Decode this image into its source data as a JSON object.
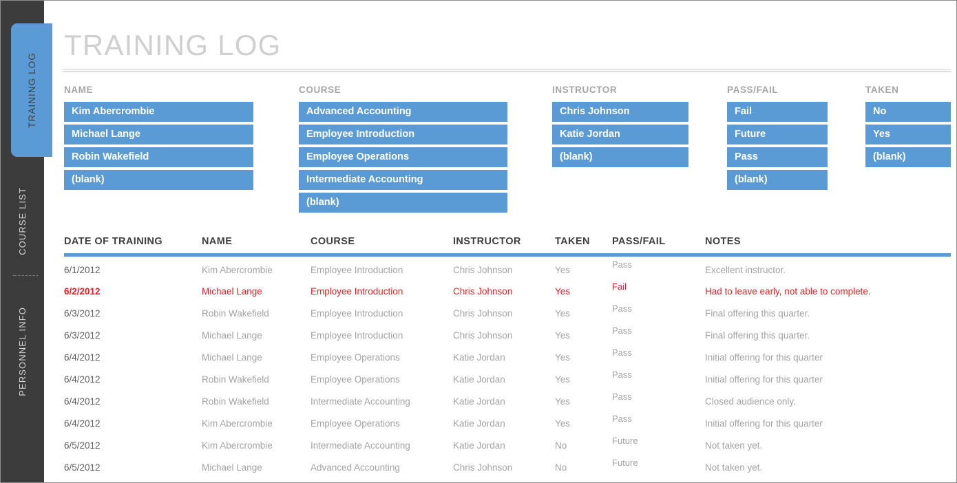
{
  "sidebar": {
    "tabs": [
      {
        "label": "TRAINING LOG",
        "active": true
      },
      {
        "label": "COURSE LIST",
        "active": false
      },
      {
        "label": "PERSONNEL INFO",
        "active": false
      }
    ]
  },
  "page": {
    "title": "TRAINING LOG",
    "accent_color": "#5B9BD5",
    "alert_color": "#EE1C25",
    "title_color": "#CFCFCF",
    "sidebar_color": "#3C3C3C"
  },
  "slicers": [
    {
      "title": "NAME",
      "items": [
        "Kim Abercrombie",
        "Michael Lange",
        "Robin Wakefield",
        "(blank)"
      ]
    },
    {
      "title": "COURSE",
      "items": [
        "Advanced Accounting",
        "Employee Introduction",
        "Employee Operations",
        "Intermediate Accounting",
        "(blank)"
      ]
    },
    {
      "title": "INSTRUCTOR",
      "items": [
        "Chris Johnson",
        "Katie Jordan",
        "(blank)"
      ]
    },
    {
      "title": "PASS/FAIL",
      "items": [
        "Fail",
        "Future",
        "Pass",
        "(blank)"
      ]
    },
    {
      "title": "TAKEN",
      "items": [
        "No",
        "Yes",
        "(blank)"
      ]
    }
  ],
  "table": {
    "columns": [
      "DATE OF TRAINING",
      "NAME",
      "COURSE",
      "INSTRUCTOR",
      "TAKEN",
      "PASS/FAIL",
      "NOTES"
    ],
    "rows": [
      {
        "date": "6/1/2012",
        "name": "Kim Abercrombie",
        "course": "Employee Introduction",
        "instructor": "Chris Johnson",
        "taken": "Yes",
        "passfail": "Pass",
        "notes": "Excellent instructor.",
        "alert": false
      },
      {
        "date": "6/2/2012",
        "name": "Michael Lange",
        "course": "Employee Introduction",
        "instructor": "Chris Johnson",
        "taken": "Yes",
        "passfail": "Fail",
        "notes": "Had to leave early, not able to complete.",
        "alert": true
      },
      {
        "date": "6/3/2012",
        "name": "Robin Wakefield",
        "course": "Employee Introduction",
        "instructor": "Chris Johnson",
        "taken": "Yes",
        "passfail": "Pass",
        "notes": "Final offering this quarter.",
        "alert": false
      },
      {
        "date": "6/3/2012",
        "name": "Michael Lange",
        "course": "Employee Introduction",
        "instructor": "Chris Johnson",
        "taken": "Yes",
        "passfail": "Pass",
        "notes": "Final offering this quarter.",
        "alert": false
      },
      {
        "date": "6/4/2012",
        "name": "Michael Lange",
        "course": "Employee Operations",
        "instructor": "Katie Jordan",
        "taken": "Yes",
        "passfail": "Pass",
        "notes": "Initial offering for this quarter",
        "alert": false
      },
      {
        "date": "6/4/2012",
        "name": "Robin Wakefield",
        "course": "Employee Operations",
        "instructor": "Katie Jordan",
        "taken": "Yes",
        "passfail": "Pass",
        "notes": "Initial offering for this quarter",
        "alert": false
      },
      {
        "date": "6/4/2012",
        "name": "Robin Wakefield",
        "course": "Intermediate Accounting",
        "instructor": "Katie Jordan",
        "taken": "Yes",
        "passfail": "Pass",
        "notes": "Closed audience only.",
        "alert": false
      },
      {
        "date": "6/4/2012",
        "name": "Kim Abercrombie",
        "course": "Employee Operations",
        "instructor": "Katie Jordan",
        "taken": "Yes",
        "passfail": "Pass",
        "notes": "Initial offering for this quarter",
        "alert": false
      },
      {
        "date": "6/5/2012",
        "name": "Kim Abercrombie",
        "course": "Intermediate Accounting",
        "instructor": "Katie Jordan",
        "taken": "No",
        "passfail": "Future",
        "notes": "Not taken yet.",
        "alert": false
      },
      {
        "date": "6/5/2012",
        "name": "Michael Lange",
        "course": "Advanced Accounting",
        "instructor": "Chris Johnson",
        "taken": "No",
        "passfail": "Future",
        "notes": "Not taken yet.",
        "alert": false
      }
    ]
  }
}
